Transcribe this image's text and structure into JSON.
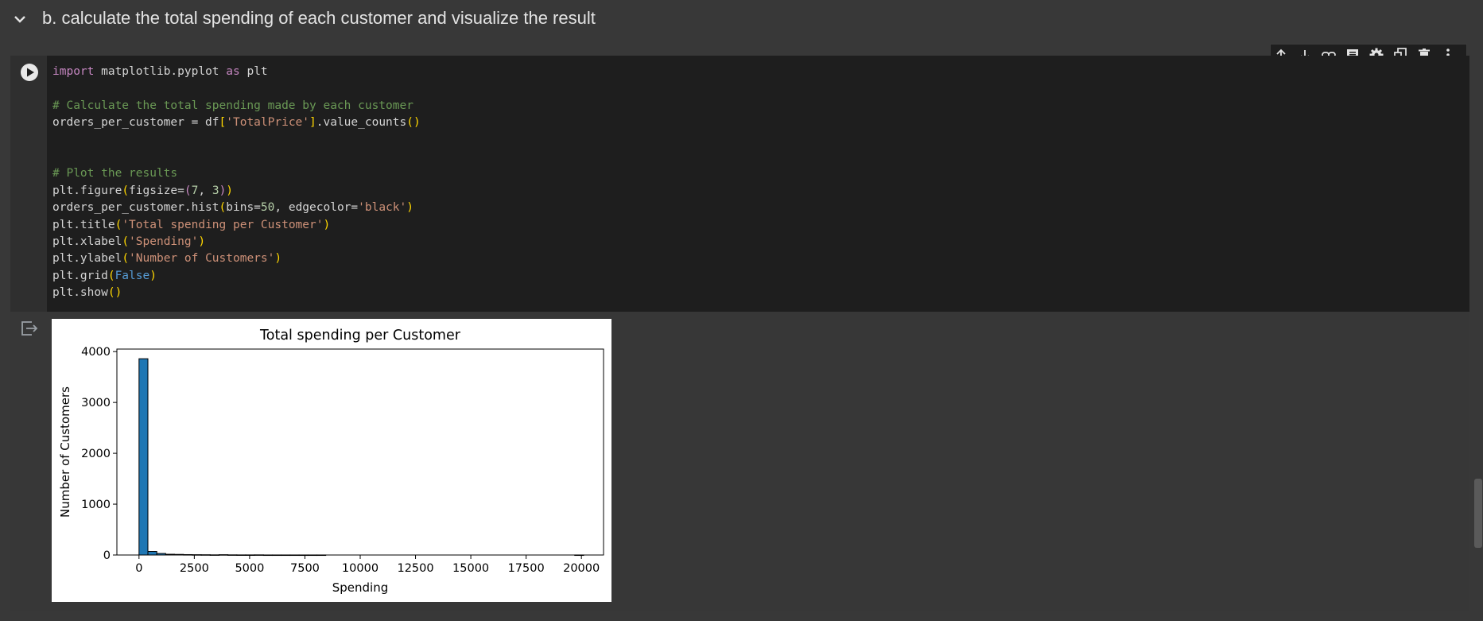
{
  "section": {
    "title": "b. calculate the total spending of each customer and visualize the result",
    "collapse_icon": "chevron-down-icon"
  },
  "cell": {
    "run_icon": "play-icon",
    "code_lines": [
      [
        {
          "t": "import",
          "c": "kw"
        },
        {
          "t": " matplotlib.pyplot "
        },
        {
          "t": "as",
          "c": "kw"
        },
        {
          "t": " plt"
        }
      ],
      [],
      [
        {
          "t": "# Calculate the total spending made by each customer",
          "c": "cm"
        }
      ],
      [
        {
          "t": "orders_per_customer = df"
        },
        {
          "t": "[",
          "c": "br"
        },
        {
          "t": "'TotalPrice'",
          "c": "st"
        },
        {
          "t": "]",
          "c": "br"
        },
        {
          "t": ".value_counts"
        },
        {
          "t": "()",
          "c": "br"
        }
      ],
      [],
      [],
      [
        {
          "t": "# Plot the results",
          "c": "cm"
        }
      ],
      [
        {
          "t": "plt.figure"
        },
        {
          "t": "(",
          "c": "br"
        },
        {
          "t": "figsize="
        },
        {
          "t": "(",
          "c": "kw"
        },
        {
          "t": "7",
          "c": "nm"
        },
        {
          "t": ", "
        },
        {
          "t": "3",
          "c": "nm"
        },
        {
          "t": ")",
          "c": "kw"
        },
        {
          "t": ")",
          "c": "br"
        }
      ],
      [
        {
          "t": "orders_per_customer.hist"
        },
        {
          "t": "(",
          "c": "br"
        },
        {
          "t": "bins="
        },
        {
          "t": "50",
          "c": "nm"
        },
        {
          "t": ", edgecolor="
        },
        {
          "t": "'black'",
          "c": "st"
        },
        {
          "t": ")",
          "c": "br"
        }
      ],
      [
        {
          "t": "plt.title"
        },
        {
          "t": "(",
          "c": "br"
        },
        {
          "t": "'Total spending per Customer'",
          "c": "st"
        },
        {
          "t": ")",
          "c": "br"
        }
      ],
      [
        {
          "t": "plt.xlabel"
        },
        {
          "t": "(",
          "c": "br"
        },
        {
          "t": "'Spending'",
          "c": "st"
        },
        {
          "t": ")",
          "c": "br"
        }
      ],
      [
        {
          "t": "plt.ylabel"
        },
        {
          "t": "(",
          "c": "br"
        },
        {
          "t": "'Number of Customers'",
          "c": "st"
        },
        {
          "t": ")",
          "c": "br"
        }
      ],
      [
        {
          "t": "plt.grid"
        },
        {
          "t": "(",
          "c": "br"
        },
        {
          "t": "False",
          "c": "bo"
        },
        {
          "t": ")",
          "c": "br"
        }
      ],
      [
        {
          "t": "plt.show"
        },
        {
          "t": "()",
          "c": "br"
        }
      ]
    ]
  },
  "toolbar": {
    "icons": [
      "arrow-up-icon",
      "arrow-down-icon",
      "link-icon",
      "comment-icon",
      "gear-icon",
      "mirror-cell-icon",
      "trash-icon",
      "more-vert-icon"
    ]
  },
  "output": {
    "icon": "output-icon"
  },
  "chart_data": {
    "type": "bar",
    "title": "Total spending per Customer",
    "xlabel": "Spending",
    "ylabel": "Number of Customers",
    "xlim": [
      -1000,
      21000
    ],
    "ylim": [
      0,
      4050
    ],
    "xticks": [
      0,
      2500,
      5000,
      7500,
      10000,
      12500,
      15000,
      17500,
      20000
    ],
    "yticks": [
      0,
      1000,
      2000,
      3000,
      4000
    ],
    "bin_width": 402,
    "bin_start": 0,
    "values": [
      3860,
      70,
      30,
      15,
      12,
      8,
      6,
      5,
      3,
      6,
      3,
      2,
      2,
      3,
      1,
      1,
      1,
      1,
      1,
      1,
      1,
      0,
      0,
      0,
      0,
      0,
      0,
      0,
      0,
      0,
      0,
      0,
      0,
      0,
      0,
      0,
      0,
      0,
      0,
      0,
      0,
      0,
      0,
      0,
      0,
      0,
      0,
      0,
      0,
      1
    ],
    "bar_color": "#1f77b4",
    "edge_color": "#000000",
    "grid": false
  }
}
